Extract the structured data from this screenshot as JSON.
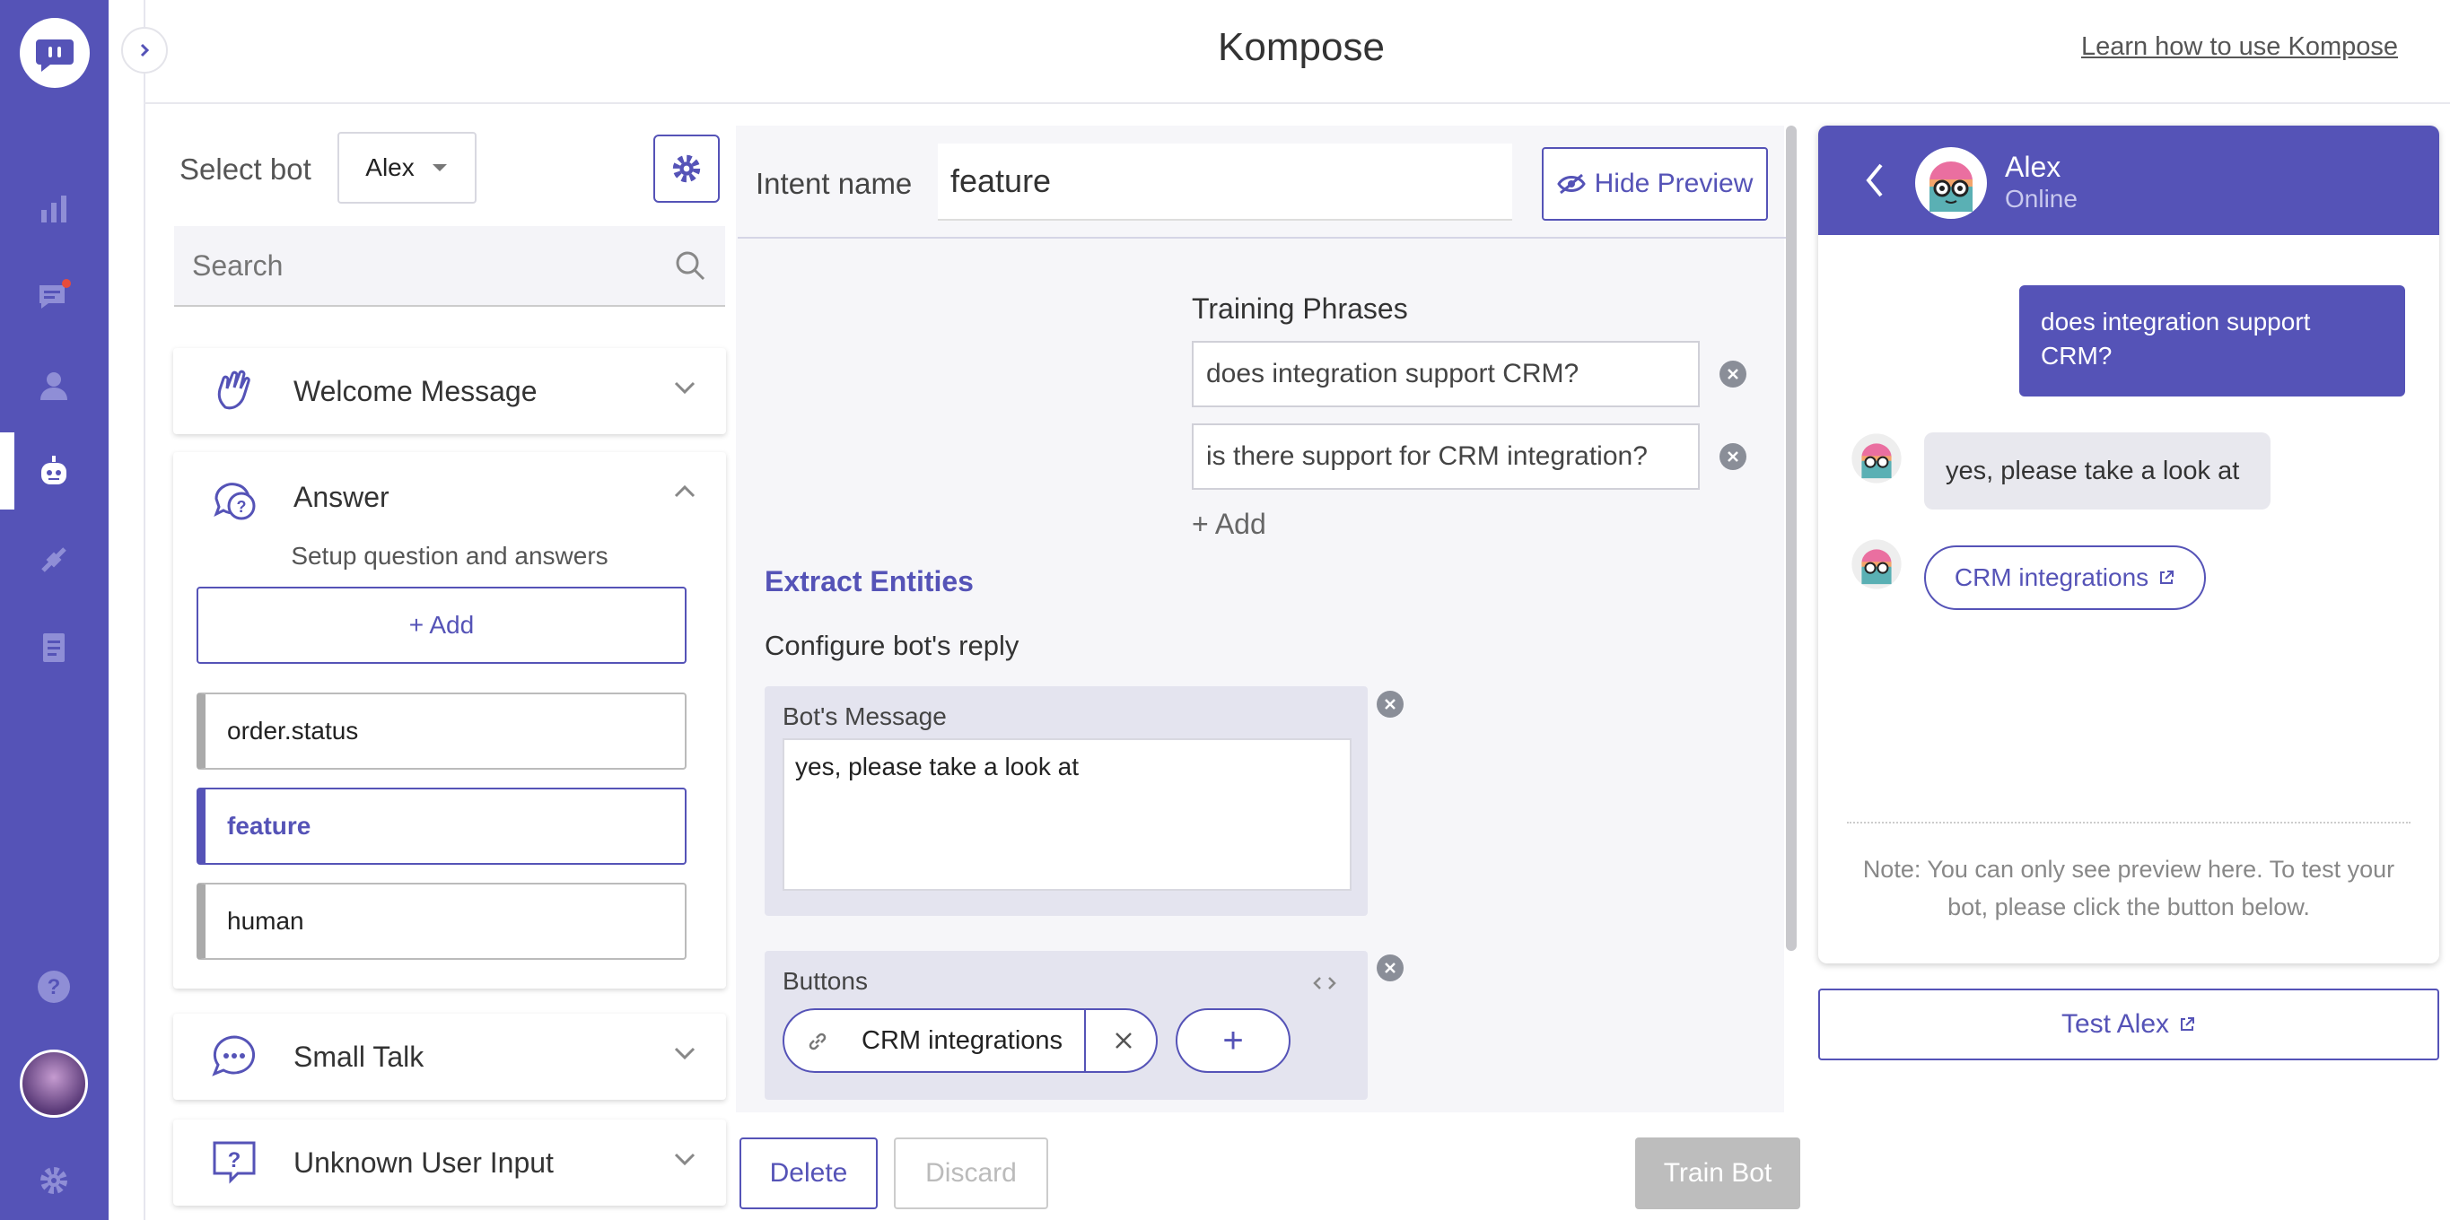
{
  "app": {
    "title": "Kompose",
    "learn_link": "Learn how to use Kompose"
  },
  "colors": {
    "primary": "#5553b7",
    "rail": "#5553b7",
    "notification": "#e74c3c",
    "disabled": "#bdbdbd"
  },
  "rail": {
    "icons": [
      "chat-logo-icon",
      "bar-chart-icon",
      "conversations-icon",
      "users-icon",
      "bot-icon",
      "integrations-icon",
      "docs-icon",
      "help-icon",
      "avatar",
      "settings-icon"
    ],
    "active": "bot-icon"
  },
  "sidebar": {
    "select_label": "Select bot",
    "bot_value": "Alex",
    "search_placeholder": "Search",
    "sections": {
      "welcome": {
        "label": "Welcome Message",
        "icon": "wave-hand-icon"
      },
      "answer": {
        "label": "Answer",
        "subtitle": "Setup question and answers",
        "add_label": "+ Add",
        "icon": "question-bubble-icon"
      },
      "smalltalk": {
        "label": "Small Talk",
        "icon": "chat-dots-icon"
      },
      "unknown": {
        "label": "Unknown User Input",
        "icon": "question-box-icon"
      }
    },
    "intents": [
      "order.status",
      "feature",
      "human"
    ],
    "selected_intent": "feature"
  },
  "editor": {
    "intent_label": "Intent name",
    "intent_value": "feature",
    "hide_preview": "Hide Preview",
    "training_label": "Training Phrases",
    "phrases": [
      "does integration support CRM?",
      "is there support for CRM integration?"
    ],
    "add_phrase": "+ Add",
    "extract_entities": "Extract Entities",
    "configure_reply": "Configure bot's reply",
    "message_label": "Bot's Message",
    "message_value": "yes, please take a look at",
    "buttons_label": "Buttons",
    "button_chip": "CRM integrations",
    "add_button": "+",
    "delete": "Delete",
    "discard": "Discard",
    "train": "Train Bot"
  },
  "preview": {
    "bot_name": "Alex",
    "status": "Online",
    "user_message": "does integration support CRM?",
    "bot_message": "yes, please take a look at",
    "bot_button": "CRM integrations",
    "note": "Note: You can only see preview here. To test your bot, please click the button below.",
    "test_button": "Test Alex"
  }
}
